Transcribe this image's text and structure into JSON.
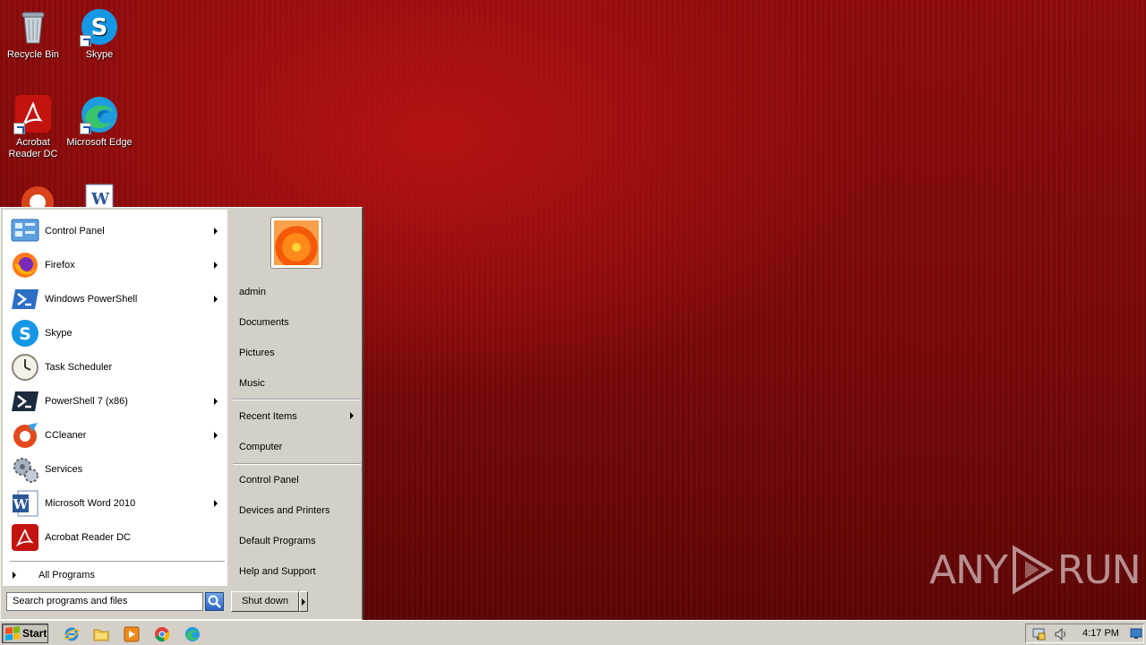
{
  "desktop": {
    "icons": [
      {
        "label": "Recycle Bin"
      },
      {
        "label": "Skype"
      },
      {
        "label": "Acrobat Reader DC"
      },
      {
        "label": "Microsoft Edge"
      }
    ],
    "watermark": {
      "left": "ANY",
      "right": "RUN"
    }
  },
  "start_menu": {
    "programs": [
      {
        "label": "Control Panel",
        "icon": "control-panel-icon",
        "submenu": true
      },
      {
        "label": "Firefox",
        "icon": "firefox-icon",
        "submenu": true
      },
      {
        "label": "Windows PowerShell",
        "icon": "powershell-icon",
        "submenu": true
      },
      {
        "label": "Skype",
        "icon": "skype-icon",
        "submenu": false
      },
      {
        "label": "Task Scheduler",
        "icon": "task-scheduler-icon",
        "submenu": false
      },
      {
        "label": "PowerShell 7 (x86)",
        "icon": "powershell7-icon",
        "submenu": true
      },
      {
        "label": "CCleaner",
        "icon": "ccleaner-icon",
        "submenu": true
      },
      {
        "label": "Services",
        "icon": "services-icon",
        "submenu": false
      },
      {
        "label": "Microsoft Word 2010",
        "icon": "word-icon",
        "submenu": true
      },
      {
        "label": "Acrobat Reader DC",
        "icon": "acrobat-icon",
        "submenu": false
      }
    ],
    "all_programs": "All Programs",
    "search_placeholder": "Search programs and files",
    "right_links": {
      "user": "admin",
      "documents": "Documents",
      "pictures": "Pictures",
      "music": "Music",
      "recent_items": "Recent Items",
      "computer": "Computer",
      "control_panel": "Control Panel",
      "devices_printers": "Devices and Printers",
      "default_programs": "Default Programs",
      "help_support": "Help and Support"
    },
    "shutdown_label": "Shut down"
  },
  "taskbar": {
    "start_label": "Start",
    "pinned": [
      "internet-explorer-icon",
      "file-explorer-icon",
      "media-player-icon",
      "chrome-icon",
      "edge-icon"
    ],
    "clock": "4:17 PM"
  }
}
